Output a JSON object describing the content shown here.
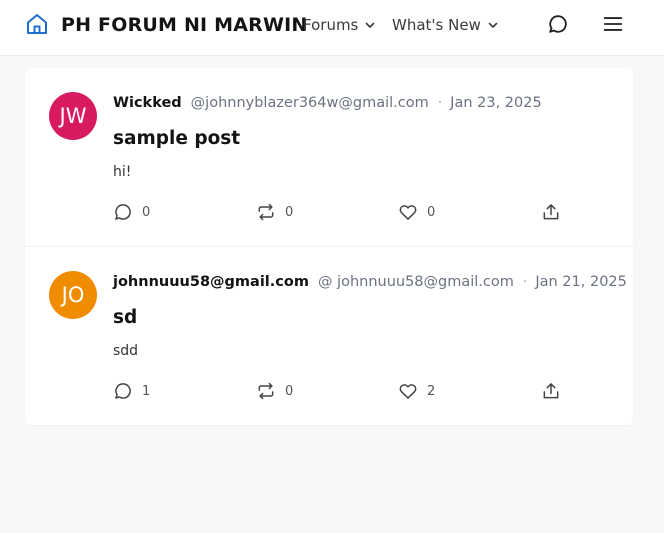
{
  "header": {
    "site_title": "PH FORUM NI MARWIN",
    "nav": [
      {
        "label": "Forums"
      },
      {
        "label": "What's New"
      }
    ],
    "accent_color": "#1f6fd1"
  },
  "posts": [
    {
      "avatar_initials": "JW",
      "avatar_color": "#d81b60",
      "author": "Wickked",
      "handle": "@johnnyblazer364w@gmail.com",
      "separator": "·",
      "date": "Jan 23, 2025",
      "title": "sample post",
      "body": "hi!",
      "comments": "0",
      "reposts": "0",
      "likes": "0"
    },
    {
      "avatar_initials": "JO",
      "avatar_color": "#f08c00",
      "author": "johnnuuu58@gmail.com",
      "handle": "@ johnnuuu58@gmail.com",
      "separator": "·",
      "date": "Jan 21, 2025",
      "title": "sd",
      "body": "sdd",
      "comments": "1",
      "reposts": "0",
      "likes": "2"
    }
  ],
  "icons": {
    "home": "home-icon",
    "chevron": "chevron-down-icon",
    "chat": "chat-bubble-icon",
    "menu": "hamburger-menu-icon",
    "comment": "comment-icon",
    "repost": "repost-icon",
    "like": "heart-icon",
    "share": "share-icon"
  }
}
